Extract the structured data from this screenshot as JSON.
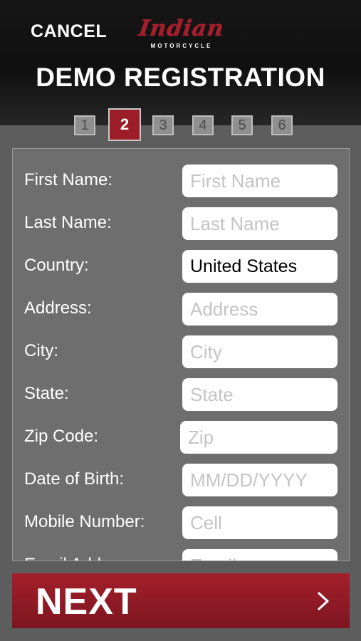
{
  "header": {
    "cancel_label": "CANCEL",
    "logo_script": "Indian",
    "logo_sub": "MOTORCYCLE",
    "title": "DEMO REGISTRATION"
  },
  "steps": [
    "1",
    "2",
    "3",
    "4",
    "5",
    "6"
  ],
  "active_step": "2",
  "form": {
    "first_name": {
      "label": "First Name:",
      "placeholder": "First Name",
      "value": ""
    },
    "last_name": {
      "label": "Last Name:",
      "placeholder": "Last Name",
      "value": ""
    },
    "country": {
      "label": "Country:",
      "placeholder": "",
      "value": "United States"
    },
    "address": {
      "label": "Address:",
      "placeholder": "Address",
      "value": ""
    },
    "city": {
      "label": "City:",
      "placeholder": "City",
      "value": ""
    },
    "state": {
      "label": "State:",
      "placeholder": "State",
      "value": ""
    },
    "zip": {
      "label": "Zip Code:",
      "placeholder": "Zip",
      "value": ""
    },
    "dob": {
      "label": "Date of Birth:",
      "placeholder": "MM/DD/YYYY",
      "value": ""
    },
    "mobile": {
      "label": "Mobile Number:",
      "placeholder": "Cell",
      "value": ""
    },
    "email": {
      "label": "Email Address:",
      "placeholder": "Email",
      "value": ""
    }
  },
  "next_label": "NEXT",
  "icons": {
    "next": "chevron-right-icon"
  },
  "colors": {
    "accent": "#9b1d28",
    "background": "#5d5d5d",
    "panel": "#6e6e6e"
  }
}
